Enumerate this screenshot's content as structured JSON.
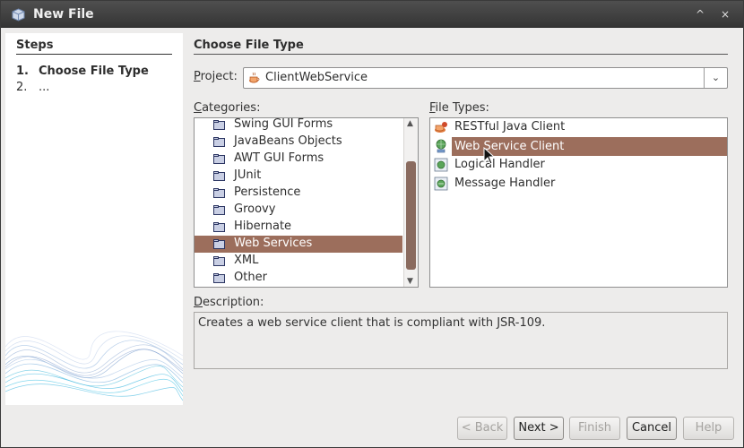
{
  "window": {
    "title": "New File",
    "minimize_glyph": "^",
    "close_glyph": "×"
  },
  "steps": {
    "title": "Steps",
    "items": [
      {
        "num": "1.",
        "label": "Choose File Type"
      },
      {
        "num": "2.",
        "label": "..."
      }
    ]
  },
  "main": {
    "section_title": "Choose File Type",
    "project_label_u": "P",
    "project_label_rest": "roject:",
    "project_value": "ClientWebService",
    "categories_label_u": "C",
    "categories_label_rest": "ategories:",
    "file_types_label_u": "F",
    "file_types_label_rest": "ile Types:",
    "description_label_u": "D",
    "description_label_rest": "escription:",
    "description_text": "Creates a web service client that is compliant with JSR-109."
  },
  "categories": [
    {
      "label": "Swing GUI Forms"
    },
    {
      "label": "JavaBeans Objects"
    },
    {
      "label": "AWT GUI Forms"
    },
    {
      "label": "JUnit"
    },
    {
      "label": "Persistence"
    },
    {
      "label": "Groovy"
    },
    {
      "label": "Hibernate"
    },
    {
      "label": "Web Services"
    },
    {
      "label": "XML"
    },
    {
      "label": "Other"
    }
  ],
  "selected_category": "Web Services",
  "file_types": [
    {
      "label": "RESTful Java Client",
      "icon": "restful-client-icon"
    },
    {
      "label": "Web Service Client",
      "icon": "web-service-client-icon"
    },
    {
      "label": "Logical Handler",
      "icon": "logical-handler-icon"
    },
    {
      "label": "Message Handler",
      "icon": "message-handler-icon"
    }
  ],
  "selected_file_type": "Web Service Client",
  "buttons": {
    "back": "< Back",
    "next": "Next >",
    "finish": "Finish",
    "cancel": "Cancel",
    "help": "Help"
  },
  "colors": {
    "selection": "#9c6e5c",
    "titlebar": "#3c3c3c",
    "panel_bg": "#edeceb"
  }
}
